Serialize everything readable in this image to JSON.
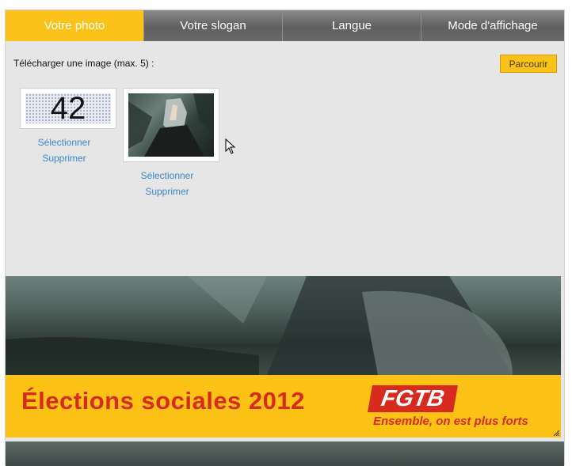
{
  "tabs": [
    {
      "label": "Votre photo",
      "active": true
    },
    {
      "label": "Votre slogan",
      "active": false
    },
    {
      "label": "Langue",
      "active": false
    },
    {
      "label": "Mode d'affichage",
      "active": false
    }
  ],
  "upload": {
    "label": "Télécharger une image (max. 5) :",
    "browse_label": "Parcourir"
  },
  "images": [
    {
      "thumb_text": "42",
      "select_label": "Sélectionner",
      "delete_label": "Supprimer"
    },
    {
      "select_label": "Sélectionner",
      "delete_label": "Supprimer"
    }
  ],
  "banner": {
    "slogan": "Élections sociales 2012",
    "logo_text": "FGTB",
    "tagline": "Ensemble, on est plus forts"
  },
  "colors": {
    "accent": "#fbc219",
    "link": "#3a86c8",
    "brand_red": "#d72b1f"
  },
  "icons": [
    "cursor-arrow-icon",
    "resize-grip-icon"
  ]
}
